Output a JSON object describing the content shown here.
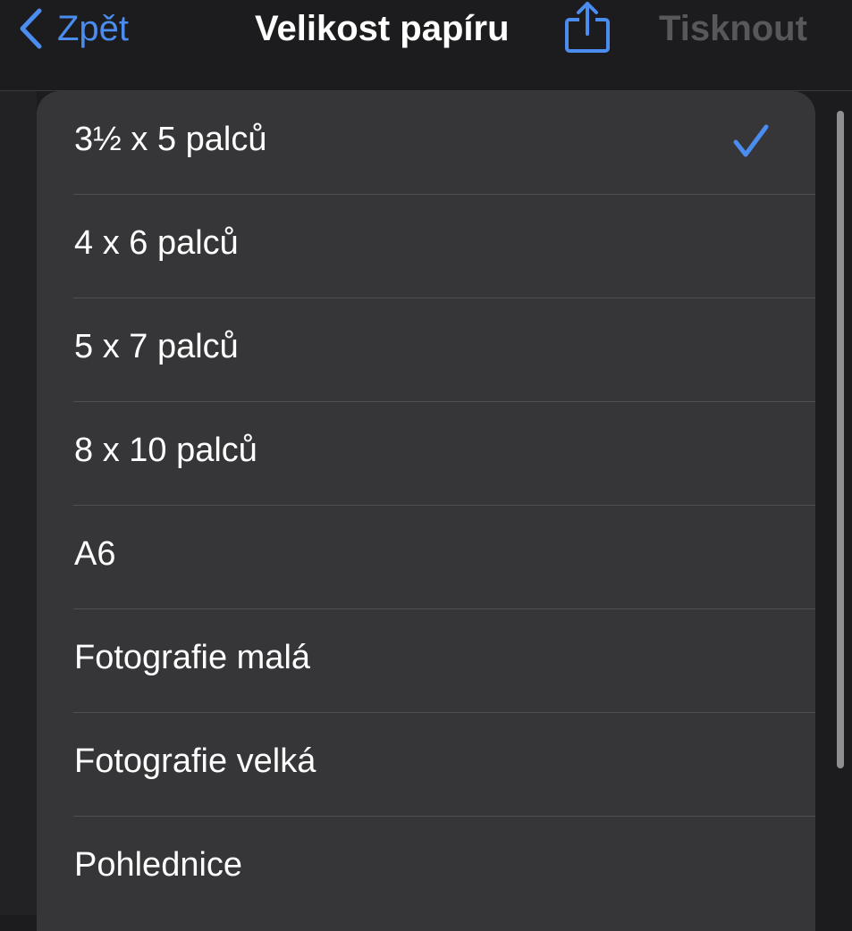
{
  "navbar": {
    "back_label": "Zpět",
    "title": "Velikost papíru",
    "share_icon": "share-icon",
    "print_label": "Tisknout"
  },
  "paper_sizes": [
    {
      "label": "3½ x 5 palců",
      "selected": true
    },
    {
      "label": "4 x 6 palců",
      "selected": false
    },
    {
      "label": "5 x 7 palců",
      "selected": false
    },
    {
      "label": "8 x 10 palců",
      "selected": false
    },
    {
      "label": "A6",
      "selected": false
    },
    {
      "label": "Fotografie malá",
      "selected": false
    },
    {
      "label": "Fotografie velká",
      "selected": false
    },
    {
      "label": "Pohlednice",
      "selected": false
    }
  ],
  "colors": {
    "accent": "#4a8cf0",
    "background": "#1c1c1e",
    "list_background": "#363638",
    "disabled_text": "#58585c"
  }
}
